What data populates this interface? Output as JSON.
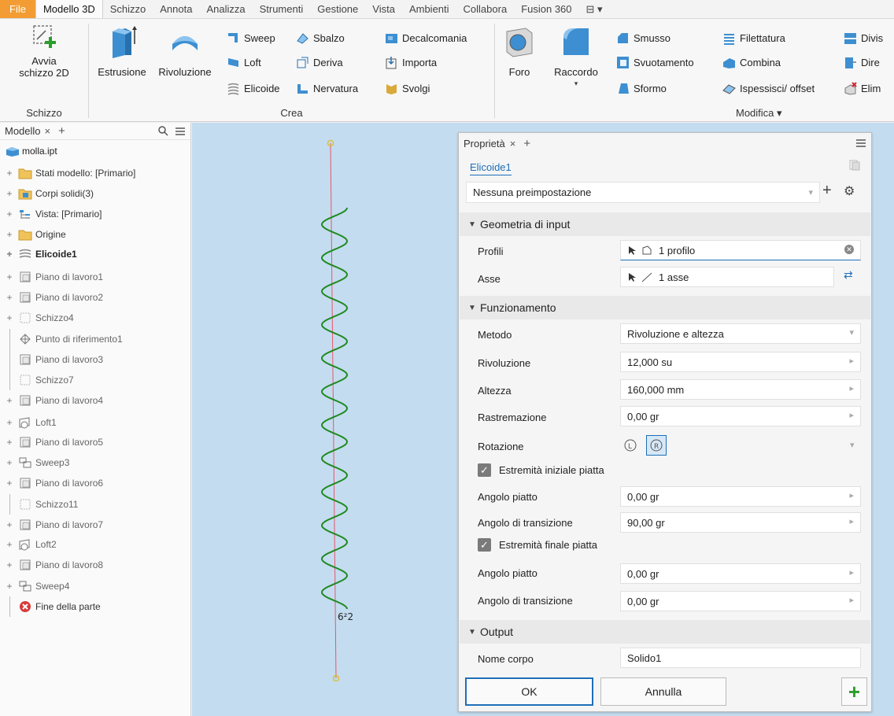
{
  "tabs": [
    "File",
    "Modello 3D",
    "Schizzo",
    "Annota",
    "Analizza",
    "Strumenti",
    "Gestione",
    "Vista",
    "Ambienti",
    "Collabora",
    "Fusion 360",
    "⊟ ▾"
  ],
  "ribbon": {
    "schizzo": {
      "label": "Schizzo",
      "start_sketch": "Avvia schizzo 2D"
    },
    "crea": {
      "label": "Crea",
      "estrusione": "Estrusione",
      "rivoluzione": "Rivoluzione",
      "sweep": "Sweep",
      "loft": "Loft",
      "elicoide": "Elicoide",
      "sbalzo": "Sbalzo",
      "deriva": "Deriva",
      "nervatura": "Nervatura",
      "decalcomania": "Decalcomania",
      "importa": "Importa",
      "svolgi": "Svolgi"
    },
    "modifica": {
      "label": "Modifica ▾",
      "foro": "Foro",
      "raccordo": "Raccordo",
      "smusso": "Smusso",
      "svuotamento": "Svuotamento",
      "sformo": "Sformo",
      "filettatura": "Filettatura",
      "combina": "Combina",
      "ispessisci": "Ispessisci/ offset",
      "dividi": "Divis",
      "diretta": "Dire",
      "elimina": "Elim"
    }
  },
  "browser": {
    "title": "Modello",
    "close": "×",
    "add": "+",
    "root": "molla.ipt",
    "items": [
      {
        "label": "Stati modello: [Primario]",
        "icon": "folder",
        "exp": "+",
        "style": ""
      },
      {
        "label": "Corpi solidi(3)",
        "icon": "folder-blue",
        "exp": "+",
        "style": ""
      },
      {
        "label": "Vista: [Primario]",
        "icon": "view",
        "exp": "+",
        "style": ""
      },
      {
        "label": "Origine",
        "icon": "folder",
        "exp": "+",
        "style": ""
      },
      {
        "label": "Elicoide1",
        "icon": "coil",
        "exp": "+",
        "style": "bold"
      },
      {
        "label": "Piano di lavoro1",
        "icon": "plane",
        "exp": "+",
        "style": "dim"
      },
      {
        "label": "Piano di lavoro2",
        "icon": "plane",
        "exp": "+",
        "style": "dim"
      },
      {
        "label": "Schizzo4",
        "icon": "sketch",
        "exp": "+",
        "style": "dim"
      },
      {
        "label": "Punto di riferimento1",
        "icon": "point",
        "exp": "",
        "style": "dim"
      },
      {
        "label": "Piano di lavoro3",
        "icon": "plane",
        "exp": "",
        "style": "dim"
      },
      {
        "label": "Schizzo7",
        "icon": "sketch",
        "exp": "",
        "style": "dim"
      },
      {
        "label": "Piano di lavoro4",
        "icon": "plane",
        "exp": "+",
        "style": "dim"
      },
      {
        "label": "Loft1",
        "icon": "loft",
        "exp": "+",
        "style": "dim"
      },
      {
        "label": "Piano di lavoro5",
        "icon": "plane",
        "exp": "+",
        "style": "dim"
      },
      {
        "label": "Sweep3",
        "icon": "sweep",
        "exp": "+",
        "style": "dim"
      },
      {
        "label": "Piano di lavoro6",
        "icon": "plane",
        "exp": "+",
        "style": "dim"
      },
      {
        "label": "Schizzo11",
        "icon": "sketch",
        "exp": "",
        "style": "dim"
      },
      {
        "label": "Piano di lavoro7",
        "icon": "plane",
        "exp": "+",
        "style": "dim"
      },
      {
        "label": "Loft2",
        "icon": "loft",
        "exp": "+",
        "style": "dim"
      },
      {
        "label": "Piano di lavoro8",
        "icon": "plane",
        "exp": "+",
        "style": "dim"
      },
      {
        "label": "Sweep4",
        "icon": "sweep",
        "exp": "+",
        "style": "dim"
      },
      {
        "label": "Fine della parte",
        "icon": "end",
        "exp": "",
        "style": ""
      }
    ]
  },
  "viewport": {
    "dim_label": "6²2"
  },
  "panel": {
    "title": "Proprietà",
    "close": "×",
    "add": "+",
    "feature": "Elicoide1",
    "preset": "Nessuna preimpostazione",
    "sections": {
      "input": "Geometria di input",
      "behavior": "Funzionamento",
      "output": "Output"
    },
    "profili": {
      "label": "Profili",
      "value": "1 profilo"
    },
    "asse": {
      "label": "Asse",
      "value": "1 asse"
    },
    "metodo": {
      "label": "Metodo",
      "value": "Rivoluzione e altezza"
    },
    "rivoluzione": {
      "label": "Rivoluzione",
      "value": "12,000 su"
    },
    "altezza": {
      "label": "Altezza",
      "value": "160,000 mm"
    },
    "rastremazione": {
      "label": "Rastremazione",
      "value": "0,00 gr"
    },
    "rotazione": {
      "label": "Rotazione"
    },
    "start_flat": {
      "label": "Estremità iniziale piatta",
      "checked": true
    },
    "start_angle": {
      "label": "Angolo piatto",
      "value": "0,00 gr"
    },
    "start_trans": {
      "label": "Angolo di transizione",
      "value": "90,00 gr"
    },
    "end_flat": {
      "label": "Estremità finale piatta",
      "checked": true
    },
    "end_angle": {
      "label": "Angolo piatto",
      "value": "0,00 gr"
    },
    "end_trans": {
      "label": "Angolo di transizione",
      "value": "0,00 gr"
    },
    "nome_corpo": {
      "label": "Nome corpo",
      "value": "Solido1"
    },
    "ok": "OK",
    "cancel": "Annulla",
    "apply": "+"
  },
  "colors": {
    "accent": "#1e6fb8",
    "file_tab": "#f39c33",
    "helix": "#1f8a1f",
    "viewport": "#c4dcef",
    "apply": "#2a9d2a"
  }
}
